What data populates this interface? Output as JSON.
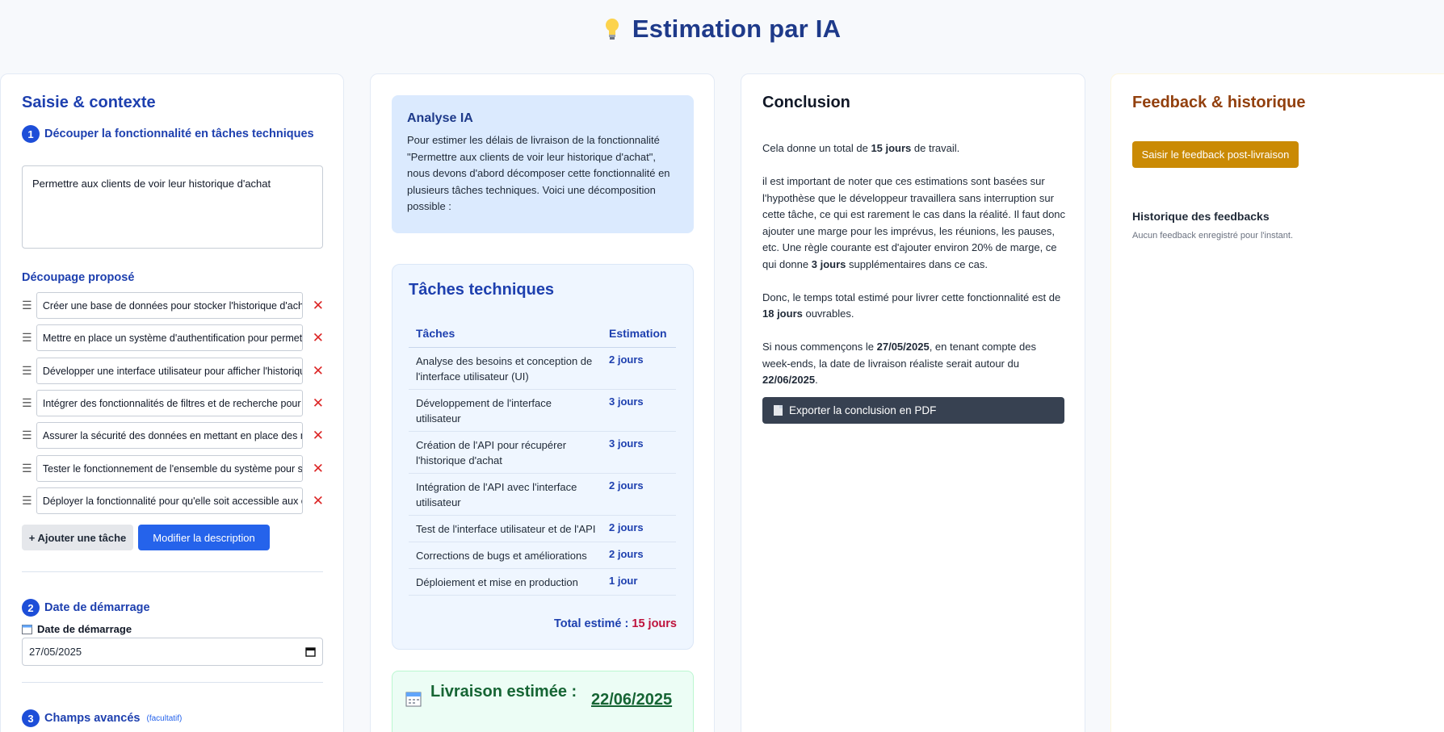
{
  "page": {
    "title": "Estimation par IA",
    "icon": "lightbulb-icon"
  },
  "input_panel": {
    "title": "Saisie & contexte",
    "step1": {
      "number": "1",
      "label": "Découper la fonctionnalité en tâches techniques"
    },
    "description_value": "Permettre aux clients de voir leur historique d'achat",
    "breakdown_label": "Découpage proposé",
    "tasks": [
      "Créer une base de données pour stocker l'historique d'achat des clients",
      "Mettre en place un système d'authentification pour permettre aux clients de se connecter",
      "Développer une interface utilisateur pour afficher l'historique d'achat",
      "Intégrer des fonctionnalités de filtres et de recherche pour faciliter la navigation",
      "Assurer la sécurité des données en mettant en place des mesures de protection",
      "Tester le fonctionnement de l'ensemble du système pour s'assurer de sa fiabilité",
      "Déployer la fonctionnalité pour qu'elle soit accessible aux clients"
    ],
    "add_task_label": "+ Ajouter une tâche",
    "edit_description_label": "Modifier la description",
    "step2": {
      "number": "2",
      "label": "Date de démarrage"
    },
    "start_date_label": "Date de démarrage",
    "start_date_value": "27/05/2025",
    "step3": {
      "number": "3",
      "label": "Champs avancés",
      "note": "(facultatif)"
    }
  },
  "analysis_panel": {
    "analysis_title": "Analyse IA",
    "analysis_text": "Pour estimer les délais de livraison de la fonctionnalité \"Permettre aux clients de voir leur historique d'achat\", nous devons d'abord décomposer cette fonctionnalité en plusieurs tâches techniques. Voici une décomposition possible :",
    "tasks_title": "Tâches techniques",
    "columns": [
      "Tâches",
      "Estimation"
    ],
    "rows": [
      {
        "task": "Analyse des besoins et conception de l'interface utilisateur (UI)",
        "estimate": "2 jours"
      },
      {
        "task": "Développement de l'interface utilisateur",
        "estimate": "3 jours"
      },
      {
        "task": "Création de l'API pour récupérer l'historique d'achat",
        "estimate": "3 jours"
      },
      {
        "task": "Intégration de l'API avec l'interface utilisateur",
        "estimate": "2 jours"
      },
      {
        "task": "Test de l'interface utilisateur et de l'API",
        "estimate": "2 jours"
      },
      {
        "task": "Corrections de bugs et améliorations",
        "estimate": "2 jours"
      },
      {
        "task": "Déploiement et mise en production",
        "estimate": "1 jour"
      }
    ],
    "total_label": "Total estimé :",
    "total_value": "15 jours",
    "delivery_label": "Livraison estimée :",
    "delivery_date": "22/06/2025"
  },
  "conclusion_panel": {
    "title": "Conclusion",
    "p1": {
      "a": "Cela donne un total de ",
      "b": "15 jours",
      "c": " de travail."
    },
    "p2": {
      "a": "il est important de noter que ces estimations sont basées sur l'hypothèse que le développeur travaillera sans interruption sur cette tâche, ce qui est rarement le cas dans la réalité. Il faut donc ajouter une marge pour les imprévus, les réunions, les pauses, etc. Une règle courante est d'ajouter environ 20% de marge, ce qui donne ",
      "b": "3 jours",
      "c": " supplémentaires dans ce cas."
    },
    "p3": {
      "a": "Donc, le temps total estimé pour livrer cette fonctionnalité est de ",
      "b": "18 jours",
      "c": " ouvrables."
    },
    "p4": {
      "a": "Si nous commençons le ",
      "b": "27/05/2025",
      "c": ", en tenant compte des week-ends, la date de livraison réaliste serait autour du ",
      "d": "22/06/2025",
      "e": "."
    },
    "export_label": "Exporter la conclusion en PDF"
  },
  "feedback_panel": {
    "title": "Feedback & historique",
    "button_label": "Saisir le feedback post-livraison",
    "history_title": "Historique des feedbacks",
    "history_empty": "Aucun feedback enregistré pour l'instant."
  },
  "colors": {
    "primary": "#1d4ed8",
    "danger": "#dc2626",
    "feedback": "#ca8a04",
    "success": "#166534"
  }
}
